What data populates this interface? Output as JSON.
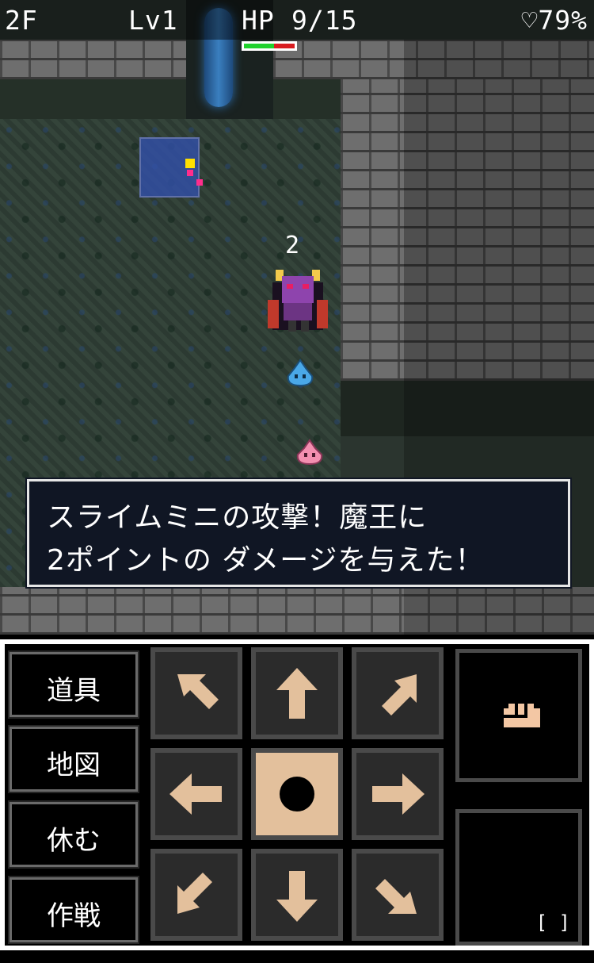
{
  "hud": {
    "floor": "2F",
    "level": "Lv1",
    "hp_label": "HP",
    "hp_value": "9/15",
    "hp_fraction": 0.6,
    "satiety": "♡79%"
  },
  "battle": {
    "damage_popup": "2",
    "message_line1": "スライムミニの攻撃！魔王に",
    "message_line2": "2ポイントの ダメージを与えた！"
  },
  "commands": {
    "items": "道具",
    "map": "地図",
    "rest": "休む",
    "tactics": "作戦"
  },
  "side": {
    "action_icon": "fist-icon",
    "slot_label": "[ ]"
  },
  "colors": {
    "hp_green": "#1fd12c",
    "hp_red": "#d81c20",
    "arrow": "#e3c09c",
    "message_bg": "#101624"
  }
}
